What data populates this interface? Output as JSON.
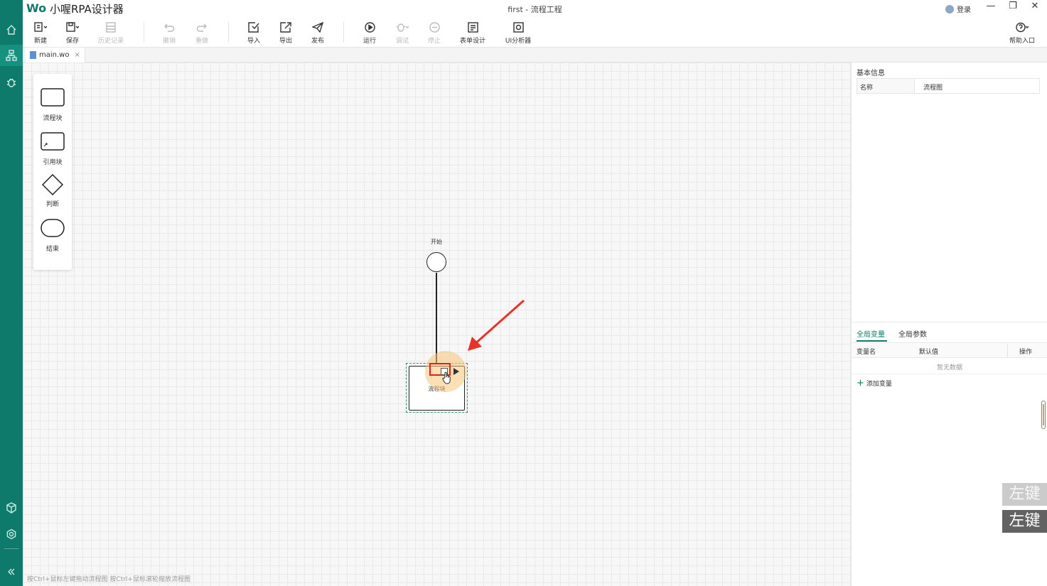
{
  "app": {
    "logo": "Wo",
    "name": "小喔RPA设计器",
    "window_title": "first - 流程工程",
    "login_label": "登录",
    "brand_color": "#0e7a6c"
  },
  "window_controls": {
    "minimize": "—",
    "restore": "❐",
    "close": "✕"
  },
  "toolbar": {
    "new_label": "新建",
    "save_label": "保存",
    "history_label": "历史记录",
    "undo_label": "撤销",
    "redo_label": "重做",
    "import_label": "导入",
    "export_label": "导出",
    "publish_label": "发布",
    "run_label": "运行",
    "debug_label": "调试",
    "stop_label": "停止",
    "form_design_label": "表单设计",
    "ui_analyzer_label": "UI分析器",
    "help_label": "帮助入口"
  },
  "tabs": [
    {
      "label": "main.wo",
      "close": "×"
    }
  ],
  "palette": {
    "items": [
      {
        "label": "流程块",
        "icon": "rectangle-shape"
      },
      {
        "label": "引用块",
        "icon": "reference-shape"
      },
      {
        "label": "判断",
        "icon": "diamond-shape"
      },
      {
        "label": "结束",
        "icon": "rounded-end-shape"
      }
    ]
  },
  "canvas": {
    "start_label": "开始",
    "block_label": "流程块",
    "hint": "按Ctrl+鼠标左键拖动流程图 按Ctrl+鼠标滚轮缩放流程图"
  },
  "right_panel": {
    "basic_info_title": "基本信息",
    "name_key": "名称",
    "name_value": "流程图",
    "tabs": [
      "全局变量",
      "全局参数"
    ],
    "columns": {
      "var_name": "变量名",
      "default": "默认值",
      "action": "操作"
    },
    "empty_text": "暂无数据",
    "add_var_label": "添加变量"
  },
  "key_overlay": {
    "top": "左键",
    "bottom": "左键"
  }
}
